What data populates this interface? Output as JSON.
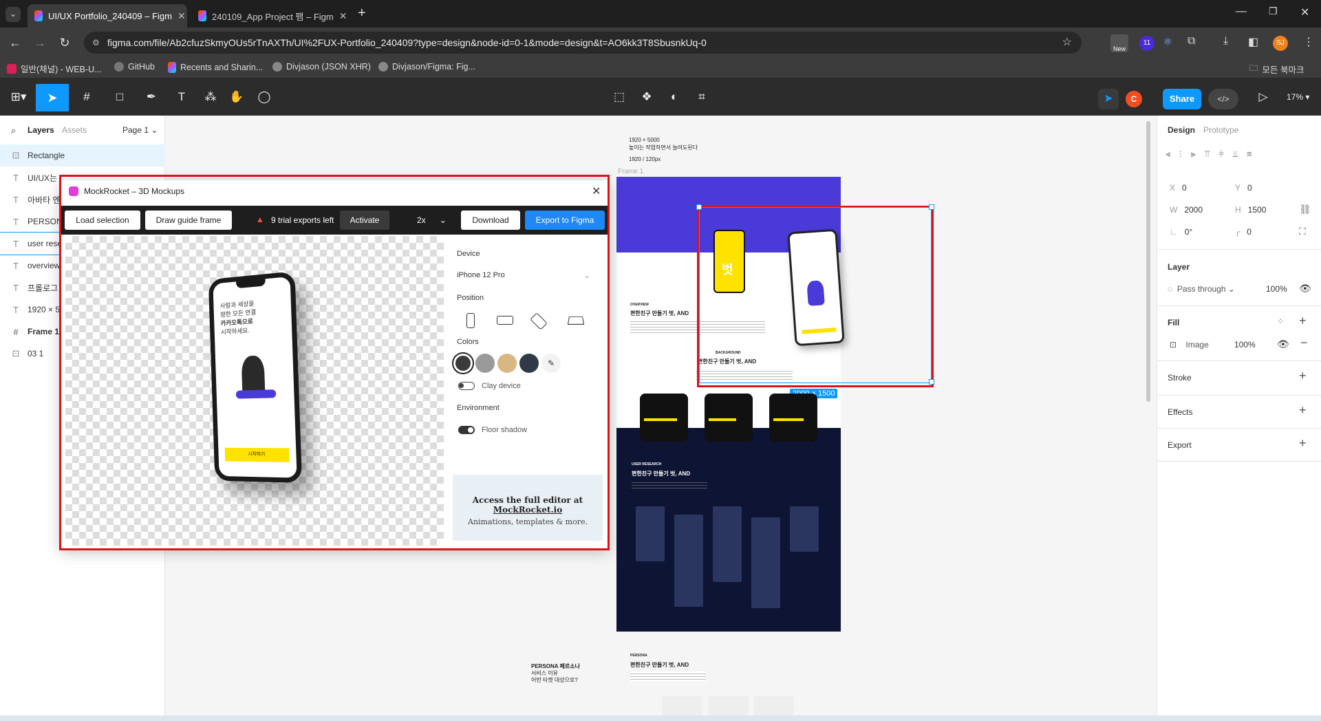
{
  "browser": {
    "tabs": [
      {
        "title": "UI/UX Portfolio_240409 – Figm"
      },
      {
        "title": "240109_App Project 팸 – Figm"
      }
    ],
    "url": "figma.com/file/Ab2cfuzSkmyOUs5rTnAXTh/UI%2FUX-Portfolio_240409?type=design&node-id=0-1&mode=design&t=AO6kk3T8SbusnkUq-0",
    "bookmarks": [
      "일반(채널) - WEB-U...",
      "GitHub",
      "Recents and Sharin...",
      "Divjason (JSON XHR)",
      "Divjason/Figma: Fig..."
    ],
    "bookmarks_folder": "모든 북마크",
    "ext_new": "New",
    "ext_badge": "11",
    "profile": "SJ"
  },
  "toolbar": {
    "share": "Share",
    "zoom": "17%",
    "avatar": "C"
  },
  "left_panel": {
    "tabs": [
      "Layers",
      "Assets"
    ],
    "page": "Page 1",
    "layers": [
      {
        "name": "Rectangle",
        "icon": "image-icon"
      },
      {
        "name": "UI/UX는",
        "icon": "text-icon"
      },
      {
        "name": "아바타 엔",
        "icon": "text-icon"
      },
      {
        "name": "PERSONA",
        "icon": "text-icon"
      },
      {
        "name": "user rese",
        "icon": "text-icon"
      },
      {
        "name": "overview",
        "icon": "text-icon"
      },
      {
        "name": "프롤로그",
        "icon": "text-icon"
      },
      {
        "name": "1920 × 5",
        "icon": "text-icon"
      },
      {
        "name": "Frame 1",
        "icon": "frame-icon"
      },
      {
        "name": "03 1",
        "icon": "image-icon"
      }
    ]
  },
  "mockrocket": {
    "title": "MockRocket – 3D Mockups",
    "load": "Load selection",
    "guide": "Draw guide frame",
    "trial": "9 trial exports left",
    "activate": "Activate",
    "scale": "2x",
    "download": "Download",
    "export": "Export to Figma",
    "device_label": "Device",
    "device": "iPhone 12 Pro",
    "position_label": "Position",
    "colors_label": "Colors",
    "clay": "Clay device",
    "env_label": "Environment",
    "floor": "Floor shadow",
    "promo_line1": "Access the full editor at ",
    "promo_link": "MockRocket.io",
    "promo_line2": "Animations, templates & more.",
    "colors": [
      "#3b3b3b",
      "#9a9a9a",
      "#d9b784",
      "#2f3a46",
      "#ffffff"
    ],
    "phone_text": [
      "사람과 세상을",
      "향한 모든 연결",
      "카카오톡으로",
      "시작하세요."
    ],
    "phone_button": "시작하기"
  },
  "canvas": {
    "note1": "1920 × 5000",
    "note2": "높이는 작업하면서 늘려도된다",
    "note3": "1920 / 120px",
    "frame_label": "Frame 1",
    "size_badge": "2000 × 1500",
    "overview_tag": "OVERVIEW",
    "overview_title": "편한친구 만들기 벗, AND",
    "bg_tag": "BACKGROUND",
    "bg_title": "편한친구 만들기 벗, AND",
    "research_tag": "USER RESEARCH",
    "research_title": "편한친구 만들기 벗, AND",
    "persona_tag": "PERSONA",
    "persona_title": "편한친구 만들기 벗, AND",
    "persona_side": [
      "PERSONA 페르소나",
      "서비스 이유",
      "어떤 타켓 대상으로?"
    ],
    "yellow_phone_text": "벗"
  },
  "right_panel": {
    "tabs": [
      "Design",
      "Prototype"
    ],
    "x": "0",
    "y": "0",
    "w": "2000",
    "h": "1500",
    "rot": "0°",
    "radius": "0",
    "layer_label": "Layer",
    "blend": "Pass through",
    "opacity": "100%",
    "fill_label": "Fill",
    "fill_type": "Image",
    "fill_opacity": "100%",
    "stroke_label": "Stroke",
    "effects_label": "Effects",
    "export_label": "Export"
  }
}
